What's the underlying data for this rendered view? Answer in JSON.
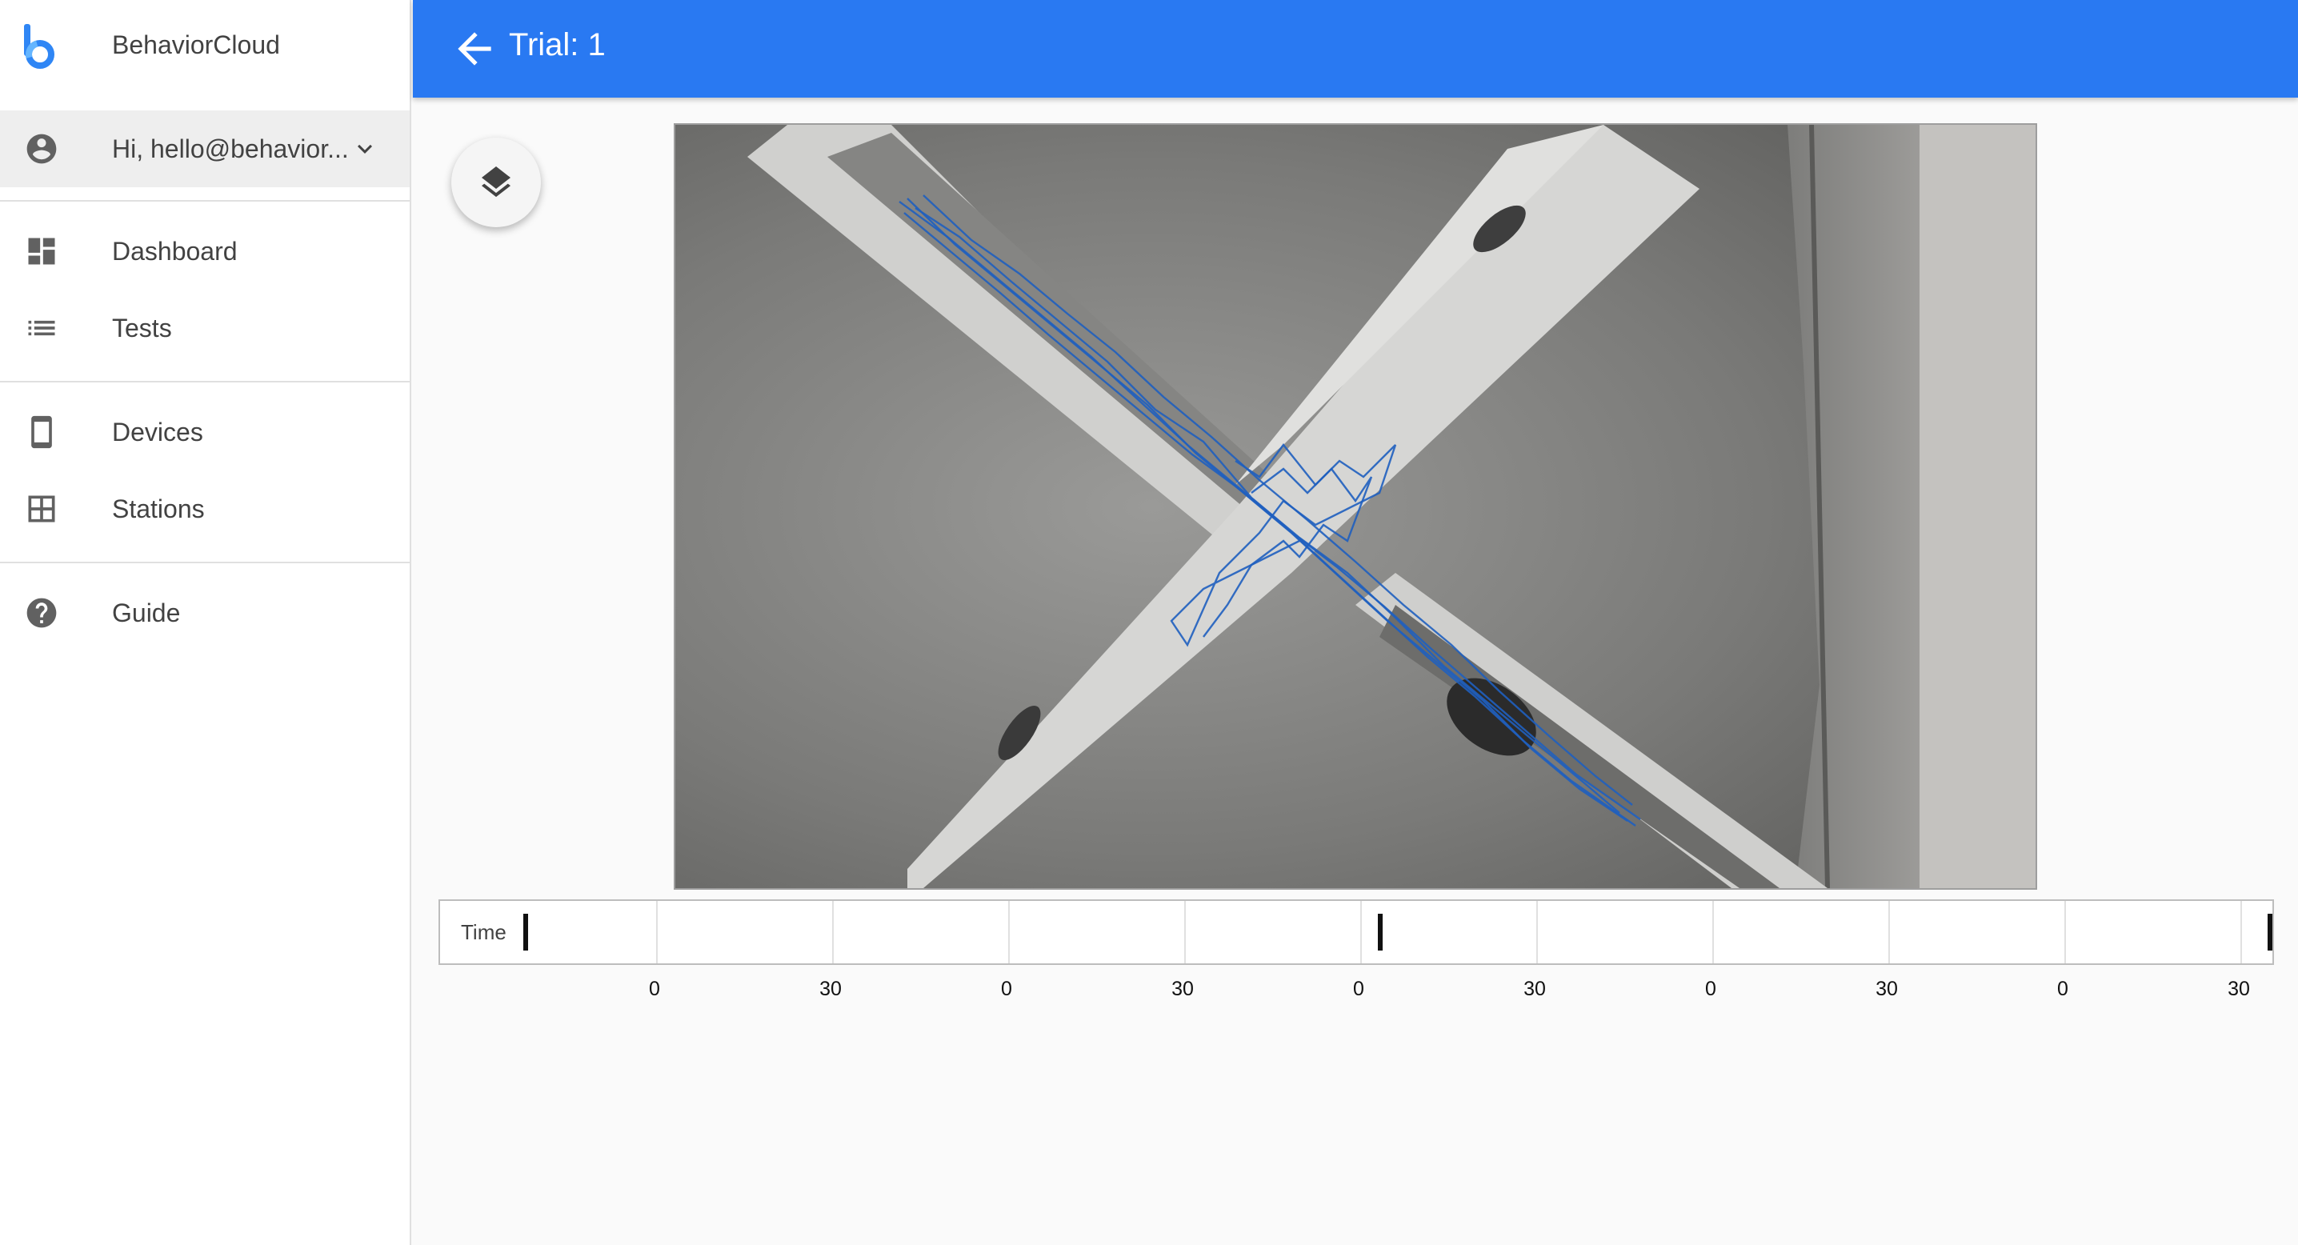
{
  "app": {
    "name": "BehaviorCloud"
  },
  "user": {
    "greeting": "Hi, hello@behavior..."
  },
  "nav": {
    "dashboard": "Dashboard",
    "tests": "Tests",
    "devices": "Devices",
    "stations": "Stations",
    "guide": "Guide"
  },
  "header": {
    "title": "Trial: 1"
  },
  "icons": {
    "logo": "behaviorcloud-logo-icon",
    "user": "account-circle-icon",
    "chevron": "chevron-down-icon",
    "dashboard": "dashboard-icon",
    "tests": "list-icon",
    "devices": "smartphone-icon",
    "stations": "grid-icon",
    "guide": "help-circle-icon",
    "back": "arrow-back-icon",
    "layers": "layers-icon"
  },
  "timeline": {
    "label": "Time",
    "tick_labels": [
      "0",
      "30",
      "0",
      "30",
      "0",
      "30",
      "0",
      "30",
      "0",
      "30"
    ],
    "marker_positions": [
      0.0,
      0.49,
      1.0
    ]
  },
  "colors": {
    "primary": "#2979f2",
    "track": "#1f5fbf"
  }
}
